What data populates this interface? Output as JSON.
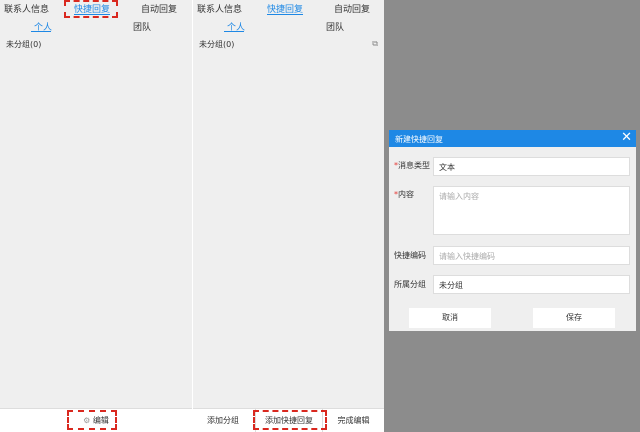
{
  "left_panel": {
    "nav": [
      "联系人信息",
      "快捷回复",
      "自动回复"
    ],
    "subtabs": [
      "个人",
      "团队"
    ],
    "group": "未分组(0)",
    "bottom_edit": "编辑"
  },
  "middle_panel": {
    "nav": [
      "联系人信息",
      "快捷回复",
      "自动回复"
    ],
    "subtabs": [
      "个人",
      "团队"
    ],
    "group": "未分组(0)",
    "bottom_actions": [
      "添加分组",
      "添加快捷回复",
      "完成编辑"
    ]
  },
  "dialog": {
    "title": "新建快捷回复",
    "fields": {
      "msg_type": {
        "required_mark": "*",
        "label": "消息类型",
        "value": "文本"
      },
      "content": {
        "required_mark": "*",
        "label": "内容",
        "placeholder": "请输入内容"
      },
      "shortcut": {
        "label": "快捷编码",
        "placeholder": "请输入快捷编码"
      },
      "group": {
        "label": "所属分组",
        "value": "未分组"
      }
    },
    "cancel": "取消",
    "save": "保存"
  },
  "colors": {
    "accent": "#1e88e5",
    "highlight_dash": "#d9281f",
    "overlay": "#8c8c8c"
  },
  "icons": {
    "edit_small": "external-edit-icon",
    "edit_bottom": "gear-icon",
    "close": "close-icon"
  }
}
